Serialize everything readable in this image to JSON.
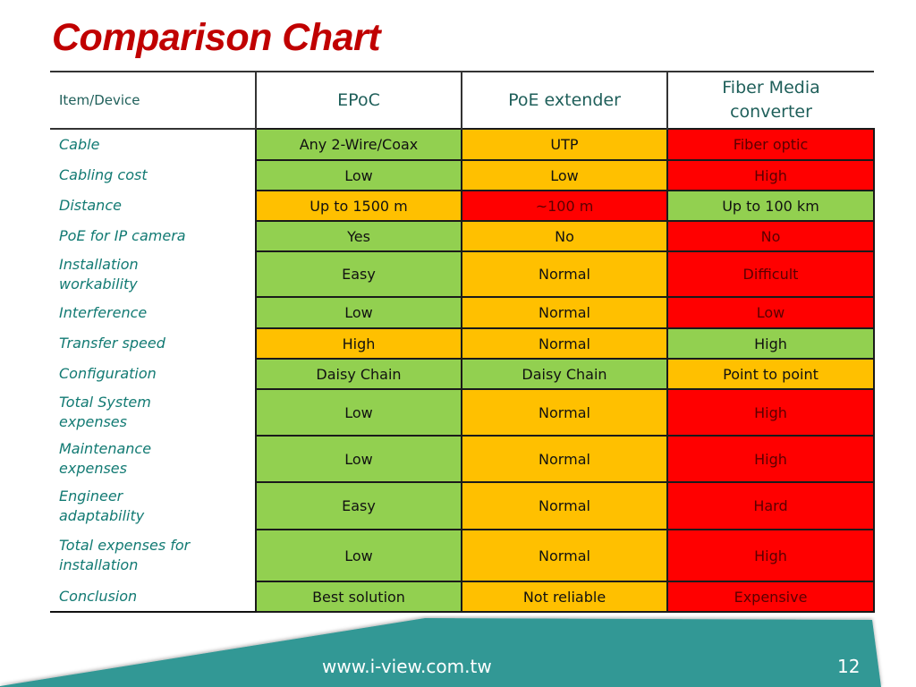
{
  "slide": {
    "title": "Comparison Chart",
    "footer_url": "www.i-view.com.tw",
    "page_number": "12",
    "colors": {
      "title": "#c00000",
      "good": "#92d050",
      "medium": "#ffc000",
      "bad": "#ff0000",
      "label_text": "#127a73",
      "footer_band": "#339895"
    }
  },
  "table": {
    "headers": [
      "Item/Device",
      "EPoC",
      "PoE extender",
      "Fiber Media converter"
    ],
    "rows": [
      {
        "label": "Cable",
        "cells": [
          {
            "text": "Any 2-Wire/Coax",
            "rating": "green"
          },
          {
            "text": "UTP",
            "rating": "amber"
          },
          {
            "text": "Fiber optic",
            "rating": "red"
          }
        ]
      },
      {
        "label": "Cabling cost",
        "cells": [
          {
            "text": "Low",
            "rating": "green"
          },
          {
            "text": "Low",
            "rating": "amber"
          },
          {
            "text": "High",
            "rating": "red"
          }
        ]
      },
      {
        "label": "Distance",
        "cells": [
          {
            "text": "Up to 1500 m",
            "rating": "amber"
          },
          {
            "text": "~100 m",
            "rating": "red"
          },
          {
            "text": "Up to 100 km",
            "rating": "green"
          }
        ]
      },
      {
        "label": "PoE for IP camera",
        "cells": [
          {
            "text": "Yes",
            "rating": "green"
          },
          {
            "text": "No",
            "rating": "amber"
          },
          {
            "text": "No",
            "rating": "red"
          }
        ]
      },
      {
        "label": "Installation workability",
        "cells": [
          {
            "text": "Easy",
            "rating": "green"
          },
          {
            "text": "Normal",
            "rating": "amber"
          },
          {
            "text": "Difficult",
            "rating": "red"
          }
        ]
      },
      {
        "label": "Interference",
        "cells": [
          {
            "text": "Low",
            "rating": "green"
          },
          {
            "text": "Normal",
            "rating": "amber"
          },
          {
            "text": "Low",
            "rating": "red"
          }
        ]
      },
      {
        "label": "Transfer speed",
        "cells": [
          {
            "text": "High",
            "rating": "amber"
          },
          {
            "text": "Normal",
            "rating": "amber"
          },
          {
            "text": "High",
            "rating": "green"
          }
        ]
      },
      {
        "label": "Configuration",
        "cells": [
          {
            "text": "Daisy Chain",
            "rating": "green"
          },
          {
            "text": "Daisy Chain",
            "rating": "green"
          },
          {
            "text": "Point to point",
            "rating": "amber"
          }
        ]
      },
      {
        "label": "Total System expenses",
        "cells": [
          {
            "text": "Low",
            "rating": "green"
          },
          {
            "text": "Normal",
            "rating": "amber"
          },
          {
            "text": "High",
            "rating": "red"
          }
        ]
      },
      {
        "label": "Maintenance expenses",
        "cells": [
          {
            "text": "Low",
            "rating": "green"
          },
          {
            "text": "Normal",
            "rating": "amber"
          },
          {
            "text": "High",
            "rating": "red"
          }
        ]
      },
      {
        "label": "Engineer adaptability",
        "cells": [
          {
            "text": "Easy",
            "rating": "green"
          },
          {
            "text": "Normal",
            "rating": "amber"
          },
          {
            "text": "Hard",
            "rating": "red"
          }
        ]
      },
      {
        "label": "Total expenses for installation",
        "cells": [
          {
            "text": "Low",
            "rating": "green"
          },
          {
            "text": "Normal",
            "rating": "amber"
          },
          {
            "text": "High",
            "rating": "red"
          }
        ]
      },
      {
        "label": "Conclusion",
        "cells": [
          {
            "text": "Best solution",
            "rating": "green"
          },
          {
            "text": "Not reliable",
            "rating": "amber"
          },
          {
            "text": "Expensive",
            "rating": "red"
          }
        ]
      }
    ]
  }
}
